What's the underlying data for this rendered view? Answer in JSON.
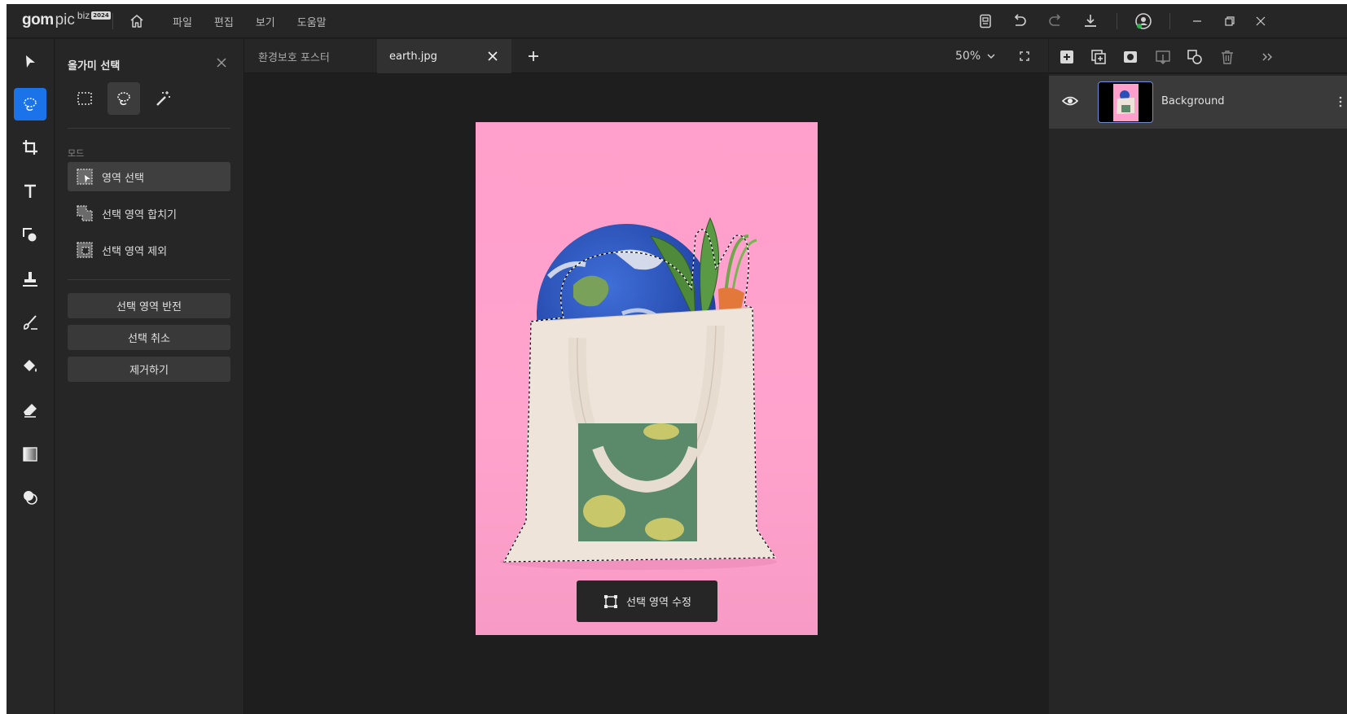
{
  "app": {
    "logo_gom": "gom",
    "logo_pic": "pic",
    "logo_biz": "biz",
    "logo_year": "2024"
  },
  "menu": [
    "파일",
    "편집",
    "보기",
    "도움말"
  ],
  "titlebar_icons": [
    "template-icon",
    "undo-icon",
    "redo-icon",
    "download-icon",
    "account-icon",
    "minimize-icon",
    "restore-icon",
    "close-icon"
  ],
  "tools": [
    "move",
    "lasso",
    "crop",
    "text",
    "shape",
    "stamp",
    "brush",
    "fill",
    "eraser",
    "gradient",
    "blend"
  ],
  "panel": {
    "title": "올가미 선택",
    "mode_label": "모드",
    "modes": [
      "영역 선택",
      "선택 영역 합치기",
      "선택 영역 제외"
    ],
    "buttons": [
      "선택 영역 반전",
      "선택 취소",
      "제거하기"
    ]
  },
  "tabs": [
    {
      "label": "환경보호 포스터",
      "active": false
    },
    {
      "label": "earth.jpg",
      "active": true
    }
  ],
  "zoom": "50%",
  "canvas": {
    "edit_selection_label": "선택 영역 수정"
  },
  "layers": [
    {
      "name": "Background",
      "visible": true
    }
  ],
  "colors": {
    "accent": "#1a73e8",
    "image_bg": "#ffa3cd"
  }
}
